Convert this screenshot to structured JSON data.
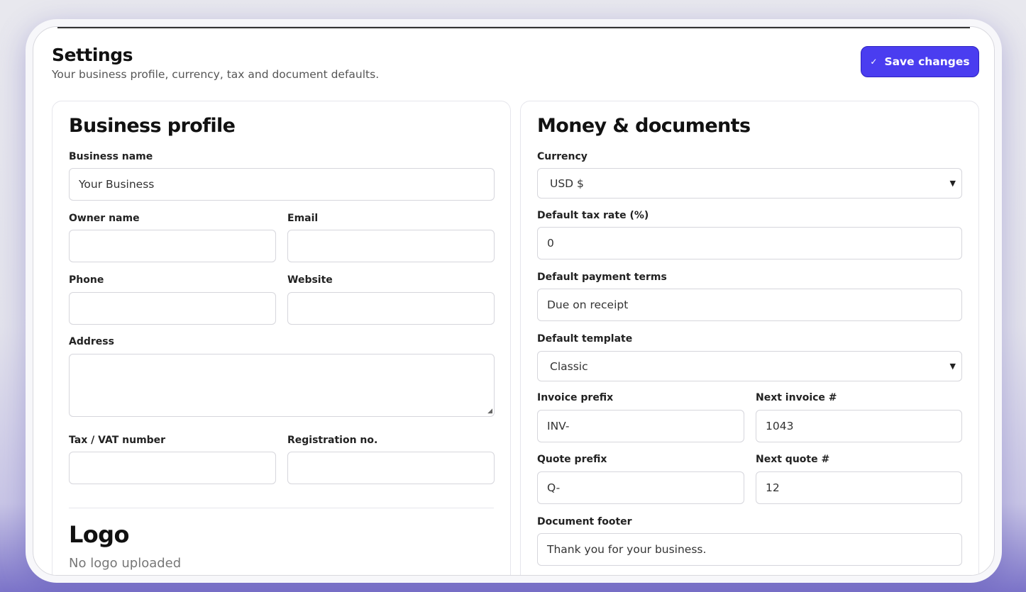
{
  "header": {
    "title": "Settings",
    "subtitle": "Your business profile, currency, tax and document defaults.",
    "save_label": "Save changes",
    "save_icon": "check-icon"
  },
  "colors": {
    "accent": "#4a3df0",
    "text": "#111111",
    "muted": "#555555"
  },
  "business_profile": {
    "title": "Business profile",
    "business_name_label": "Business name",
    "business_name_value": "Your Business",
    "owner_name_label": "Owner name",
    "owner_name_value": "",
    "email_label": "Email",
    "email_value": "",
    "phone_label": "Phone",
    "phone_value": "",
    "website_label": "Website",
    "website_value": "",
    "address_label": "Address",
    "address_value": "",
    "tax_label": "Tax / VAT number",
    "tax_value": "",
    "registration_label": "Registration no.",
    "registration_value": ""
  },
  "logo": {
    "title": "Logo",
    "status": "No logo uploaded"
  },
  "money_documents": {
    "title": "Money & documents",
    "currency_label": "Currency",
    "currency_value": "USD $",
    "tax_rate_label": "Default tax rate (%)",
    "tax_rate_value": "0",
    "payment_terms_label": "Default payment terms",
    "payment_terms_value": "Due on receipt",
    "template_label": "Default template",
    "template_value": "Classic",
    "invoice_prefix_label": "Invoice prefix",
    "invoice_prefix_value": "INV-",
    "next_invoice_label": "Next invoice #",
    "next_invoice_value": "1043",
    "quote_prefix_label": "Quote prefix",
    "quote_prefix_value": "Q-",
    "next_quote_label": "Next quote #",
    "next_quote_value": "12",
    "footer_label": "Document footer",
    "footer_value": "Thank you for your business."
  }
}
